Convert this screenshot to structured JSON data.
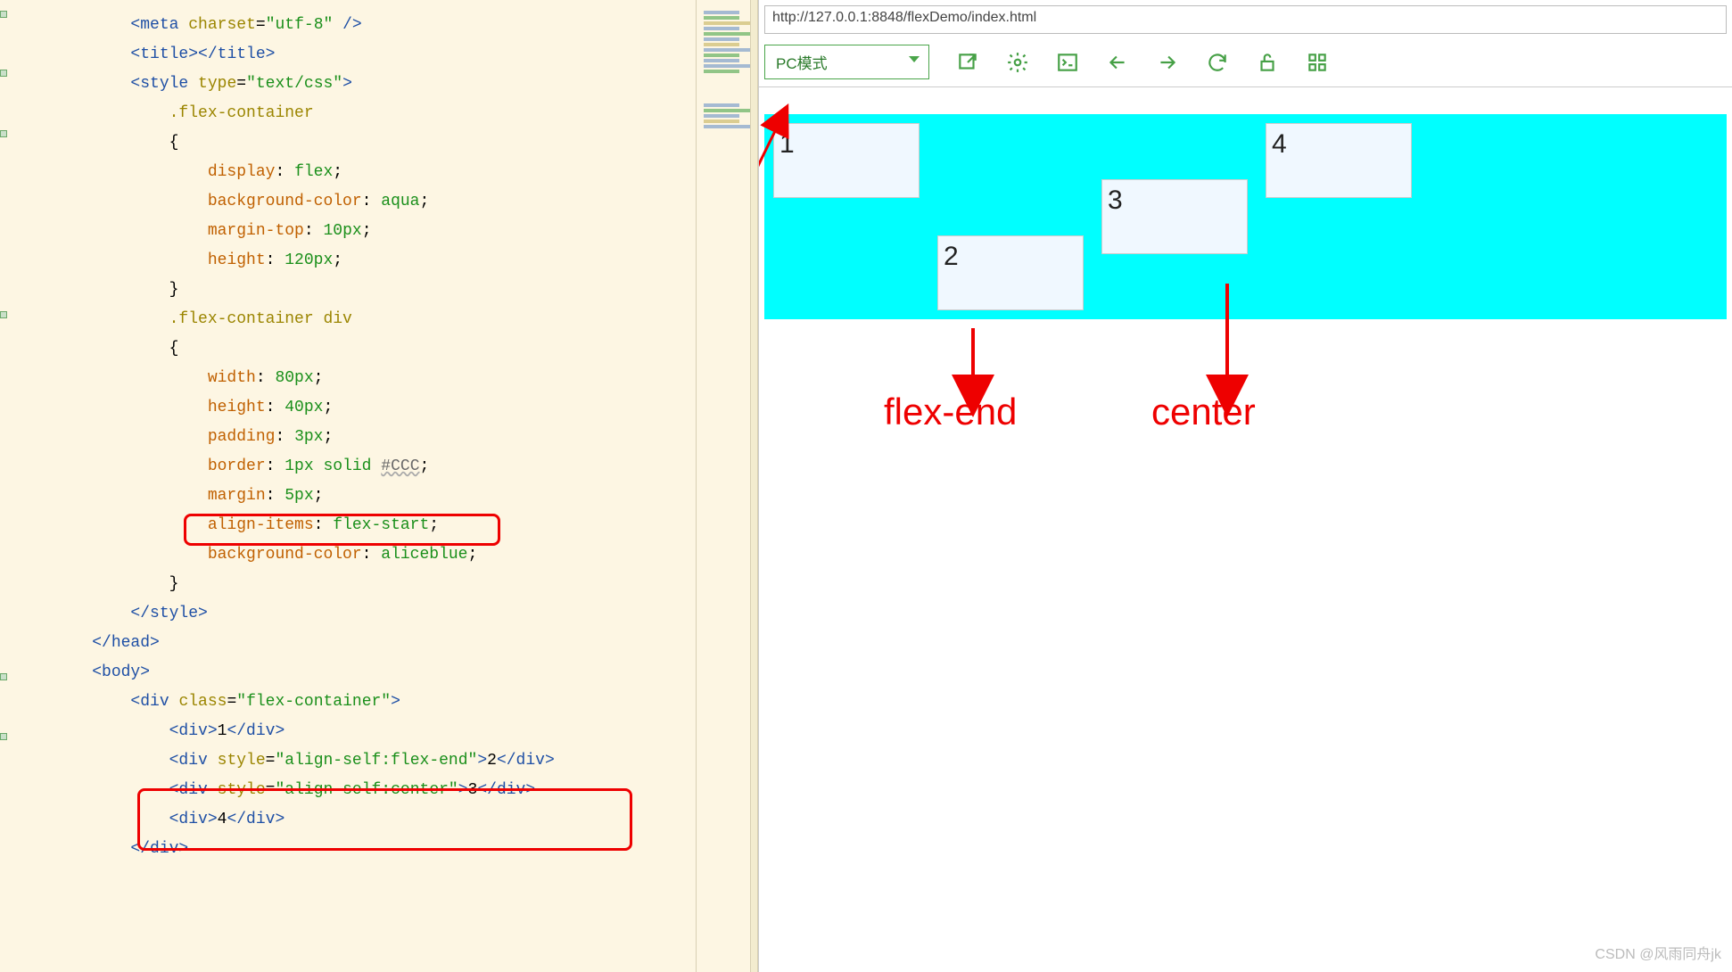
{
  "editor": {
    "lines": [
      {
        "html": "<span class='tag'>&lt;meta</span> <span class='attr'>charset</span>=<span class='str'>\"utf-8\"</span> <span class='tag'>/&gt;</span>",
        "indent": 2
      },
      {
        "html": "<span class='tag'>&lt;title&gt;&lt;/title&gt;</span>",
        "indent": 2
      },
      {
        "html": "<span class='tag'>&lt;style</span> <span class='attr'>type</span>=<span class='str'>\"text/css\"</span><span class='tag'>&gt;</span>",
        "indent": 2
      },
      {
        "html": "<span class='sel'>.flex-container</span>",
        "indent": 3
      },
      {
        "html": "{",
        "indent": 3
      },
      {
        "html": "<span class='prop'>display</span>: <span class='val'>flex</span>;",
        "indent": 4
      },
      {
        "html": "<span class='prop'>background-color</span>: <span class='val'>aqua</span>;",
        "indent": 4
      },
      {
        "html": "<span class='prop'>margin-top</span>: <span class='num'>10px</span>;",
        "indent": 4
      },
      {
        "html": "<span class='prop'>height</span>: <span class='num'>120px</span>;",
        "indent": 4
      },
      {
        "html": "}",
        "indent": 3
      },
      {
        "html": "<span class='sel'>.flex-container div</span>",
        "indent": 3
      },
      {
        "html": "{",
        "indent": 3
      },
      {
        "html": "<span class='prop'>width</span>: <span class='num'>80px</span>;",
        "indent": 4
      },
      {
        "html": "<span class='prop'>height</span>: <span class='num'>40px</span>;",
        "indent": 4
      },
      {
        "html": "<span class='prop'>padding</span>: <span class='num'>3px</span>;",
        "indent": 4
      },
      {
        "html": "<span class='prop'>border</span>: <span class='num'>1px</span> <span class='val'>solid</span> <span class='colorhex'>#CCC</span>;",
        "indent": 4
      },
      {
        "html": "<span class='prop'>margin</span>: <span class='num'>5px</span>;",
        "indent": 4
      },
      {
        "html": "<span class='prop'>align-items</span>: <span class='val'>flex-start</span>;",
        "indent": 4
      },
      {
        "html": "<span class='prop'>background-color</span>: <span class='val'>aliceblue</span>;",
        "indent": 4
      },
      {
        "html": "}",
        "indent": 3
      },
      {
        "html": "<span class='tag'>&lt;/style&gt;</span>",
        "indent": 2
      },
      {
        "html": "<span class='tag'>&lt;/head&gt;</span>",
        "indent": 1
      },
      {
        "html": "<span class='tag'>&lt;body&gt;</span>",
        "indent": 1
      },
      {
        "html": "",
        "indent": 0
      },
      {
        "html": "<span class='tag'>&lt;div</span> <span class='attr'>class</span>=<span class='str'>\"flex-container\"</span><span class='tag'>&gt;</span>",
        "indent": 2
      },
      {
        "html": "<span class='tag'>&lt;div&gt;</span>1<span class='tag'>&lt;/div&gt;</span>",
        "indent": 3
      },
      {
        "html": "<span class='tag'>&lt;div</span> <span class='attr'>style</span>=<span class='str'>\"align-self:flex-end\"</span><span class='tag'>&gt;</span>2<span class='tag'>&lt;/div&gt;</span>",
        "indent": 3
      },
      {
        "html": "<span class='tag'>&lt;div</span> <span class='attr'>style</span>=<span class='str'>\"align-self:center\"</span><span class='tag'>&gt;</span>3<span class='tag'>&lt;/div&gt;</span>",
        "indent": 3
      },
      {
        "html": "<span class='tag'>&lt;div&gt;</span>4<span class='tag'>&lt;/div&gt;</span>",
        "indent": 3
      },
      {
        "html": "<span class='tag'>&lt;/div&gt;</span>",
        "indent": 2
      }
    ]
  },
  "browser": {
    "url": "http://127.0.0.1:8848/flexDemo/index.html",
    "mode_label": "PC模式",
    "boxes": [
      "1",
      "2",
      "3",
      "4"
    ]
  },
  "annotations": {
    "label_flex_end": "flex-end",
    "label_center": "center"
  },
  "watermark": "CSDN @风雨同舟jk"
}
